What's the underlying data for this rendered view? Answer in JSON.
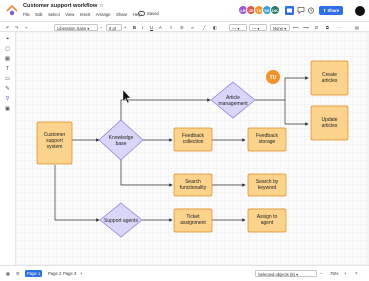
{
  "app": {
    "title": "Customer support workflow",
    "star_glyph": "☆",
    "menu": [
      "File",
      "Edit",
      "Select",
      "View",
      "Insert",
      "Arrange",
      "Share",
      "Help"
    ],
    "saved_label": "Saved",
    "share_label": "Share",
    "collaborators": [
      {
        "initials": "LR",
        "color": "#9b59d0"
      },
      {
        "initials": "JD",
        "color": "#e2574c"
      },
      {
        "initials": "TU",
        "color": "#f0932b"
      },
      {
        "initials": "SK",
        "color": "#3aa0d8"
      },
      {
        "initials": "DK",
        "color": "#2e7d6b"
      }
    ],
    "brand_color": "#2f6fe4"
  },
  "toolbar": {
    "undo_icon": "↶",
    "redo_icon": "↷",
    "font_family": "Liberation Sans",
    "font_size": "8 pt",
    "bold": "B",
    "italic": "I",
    "underline": "U",
    "text_color": "A",
    "line_label": "None"
  },
  "diagram": {
    "nodes": [
      {
        "id": "customer-support-system",
        "lines": [
          "Customer",
          "support",
          "system"
        ]
      },
      {
        "id": "knowledge-base",
        "lines": [
          "Knowledge",
          "base"
        ]
      },
      {
        "id": "article-management",
        "lines": [
          "Article",
          "management"
        ]
      },
      {
        "id": "feedback-collection",
        "lines": [
          "Feedback",
          "collection"
        ]
      },
      {
        "id": "feedback-storage",
        "lines": [
          "Feedback",
          "storage"
        ]
      },
      {
        "id": "search-functionality",
        "lines": [
          "Search",
          "functionality"
        ]
      },
      {
        "id": "search-by-keyword",
        "lines": [
          "Search by",
          "keyword"
        ]
      },
      {
        "id": "support-agents",
        "lines": [
          "Support agents"
        ]
      },
      {
        "id": "ticket-assignment",
        "lines": [
          "Ticket",
          "assignment"
        ]
      },
      {
        "id": "assign-to-agent",
        "lines": [
          "Assign to",
          "agent"
        ]
      },
      {
        "id": "create-articles",
        "lines": [
          "Create",
          "articles"
        ]
      },
      {
        "id": "update-articles",
        "lines": [
          "Update",
          "articles"
        ]
      }
    ],
    "cursor_user": "TU",
    "colors": {
      "process_fill": "#fbd38d",
      "process_stroke": "#e08a1e",
      "decision_fill": "#d9d6f7",
      "decision_stroke": "#8a7fd6",
      "connector": "#333333",
      "cursor_badge": "#f0932b"
    }
  },
  "footer": {
    "pages": [
      "Page 1",
      "Page 2",
      "Page 3"
    ],
    "add_page": "+",
    "selection_label": "Selected objects (6)",
    "zoom": "75%"
  }
}
